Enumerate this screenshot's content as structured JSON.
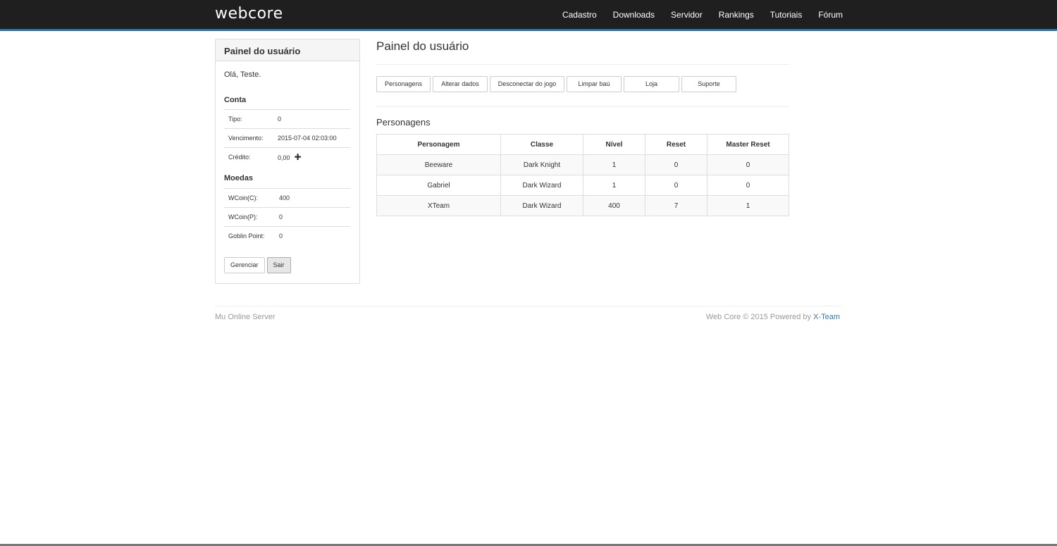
{
  "header": {
    "brand": "webcore",
    "nav": [
      "Cadastro",
      "Downloads",
      "Servidor",
      "Rankings",
      "Tutoriais",
      "Fórum"
    ]
  },
  "sidebar": {
    "title": "Painel do usuário",
    "greeting": "Olá, Teste.",
    "account_title": "Conta",
    "account": [
      {
        "label": "Tipo:",
        "value": "0"
      },
      {
        "label": "Vencimento:",
        "value": "2015-07-04 02:03:00"
      },
      {
        "label": "Crédito:",
        "value": "0,00"
      }
    ],
    "coins_title": "Moedas",
    "coins": [
      {
        "label": "WCoin(C):",
        "value": "400"
      },
      {
        "label": "WCoin(P):",
        "value": "0"
      },
      {
        "label": "Goblin Point:",
        "value": "0"
      }
    ],
    "manage_label": "Gerenciar",
    "logout_label": "Sair",
    "plus_glyph": "✚"
  },
  "main": {
    "title": "Painel do usuário",
    "actions": [
      "Personagens",
      "Alterar dados",
      "Desconectar do jogo",
      "Limpar baú",
      "Loja",
      "Suporte"
    ],
    "section_title": "Personagens",
    "table": {
      "columns": [
        "Personagem",
        "Classe",
        "Nível",
        "Reset",
        "Master Reset"
      ],
      "rows": [
        [
          "Beeware",
          "Dark Knight",
          "1",
          "0",
          "0"
        ],
        [
          "Gabriel",
          "Dark Wizard",
          "1",
          "0",
          "0"
        ],
        [
          "XTeam",
          "Dark Wizard",
          "400",
          "7",
          "1"
        ]
      ]
    }
  },
  "footer": {
    "left": "Mu Online Server",
    "right_prefix": "Web Core © 2015 Powered by",
    "right_link": "X-Team"
  }
}
